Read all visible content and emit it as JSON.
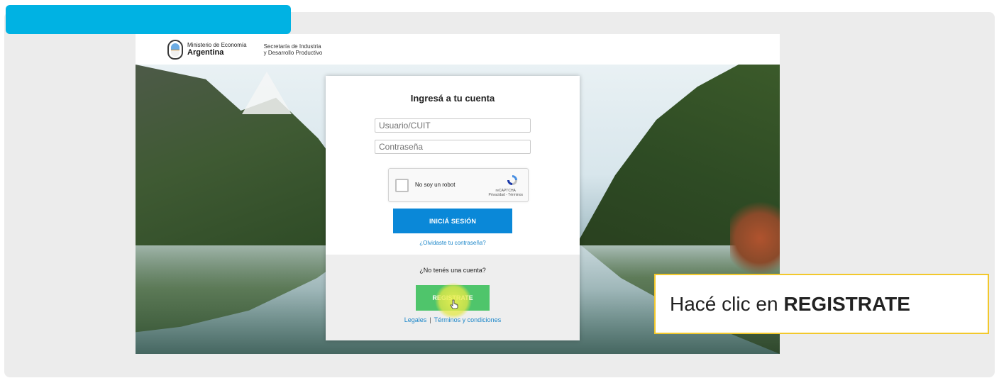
{
  "header": {
    "ministry_line1": "Ministerio de Economía",
    "ministry_line2": "Argentina",
    "secretaria_line1": "Secretaría de Industria",
    "secretaria_line2": "y Desarrollo Productivo"
  },
  "login": {
    "title": "Ingresá a tu cuenta",
    "user_placeholder": "Usuario/CUIT",
    "password_placeholder": "Contraseña",
    "captcha_label": "No soy un robot",
    "captcha_brand": "reCAPTCHA",
    "captcha_links": "Privacidad - Términos",
    "login_button": "INICIÁ SESIÓN",
    "forgot_link": "¿Olvidaste tu contraseña?",
    "no_account": "¿No tenés una cuenta?",
    "register_button": "REGISTRATE",
    "legal_link": "Legales",
    "separator": "|",
    "terms_link": "Términos y condiciones"
  },
  "callout": {
    "prefix": "Hacé clic en",
    "emphasis": "REGISTRATE"
  },
  "colors": {
    "tab_accent": "#00b2e3",
    "login_button": "#0a88d8",
    "register_button": "#4fc56b",
    "link": "#1b86c9",
    "callout_border": "#f2c82c"
  }
}
